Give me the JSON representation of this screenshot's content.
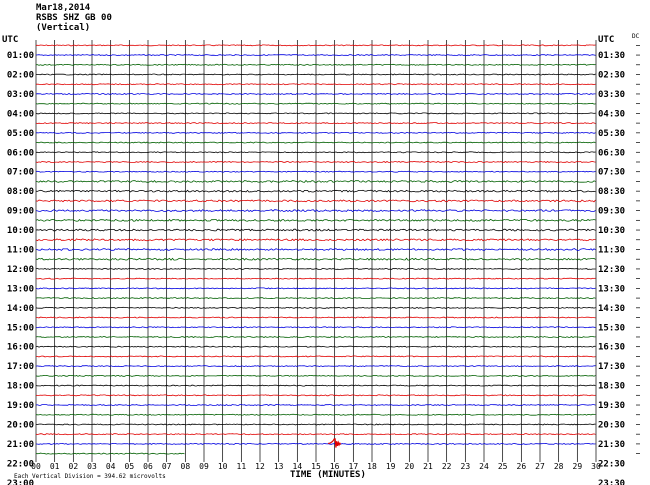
{
  "header": {
    "date": "Mar18,2014",
    "station": "RSBS SHZ GB 00",
    "component": "(Vertical)"
  },
  "axis": {
    "left_label": "UTC",
    "right_label": "UTC",
    "dc_label": "DC",
    "x_title": "TIME (MINUTES)",
    "footnote": "Each Vertical Division =  394.62 microvolts"
  },
  "colors": {
    "trace_cycle": [
      "#000000",
      "#e00000",
      "#0000e0",
      "#006000"
    ],
    "grid": "#000000"
  },
  "chart_data": {
    "type": "line",
    "title": "Mar18,2014 RSBS SHZ GB 00 (Vertical)",
    "xlabel": "TIME (MINUTES)",
    "ylabel": "UTC",
    "xlim": [
      0,
      30
    ],
    "x_ticks": [
      "00",
      "01",
      "02",
      "03",
      "04",
      "05",
      "06",
      "07",
      "08",
      "09",
      "10",
      "11",
      "12",
      "13",
      "14",
      "15",
      "16",
      "17",
      "18",
      "19",
      "20",
      "21",
      "22",
      "23",
      "24",
      "25",
      "26",
      "27",
      "28",
      "29",
      "30"
    ],
    "left_hour_labels": [
      "01:00",
      "02:00",
      "03:00",
      "04:00",
      "05:00",
      "06:00",
      "07:00",
      "08:00",
      "09:00",
      "10:00",
      "11:00",
      "12:00",
      "13:00",
      "14:00",
      "15:00",
      "16:00",
      "17:00",
      "18:00",
      "19:00",
      "20:00",
      "21:00",
      "22:00",
      "23:00"
    ],
    "right_hour_labels": [
      "01:30",
      "02:30",
      "03:30",
      "04:30",
      "05:30",
      "06:30",
      "07:30",
      "08:30",
      "09:30",
      "10:30",
      "11:30",
      "12:30",
      "13:30",
      "14:30",
      "15:30",
      "16:30",
      "17:30",
      "18:30",
      "19:30",
      "20:30",
      "21:30",
      "22:30",
      "23:30"
    ],
    "trace_rows": 43,
    "last_trace_end_minute": 8,
    "events": [
      {
        "row": 42,
        "minute": 16,
        "color": "#e00000",
        "label": "earthquake signal"
      }
    ],
    "grid": true
  }
}
